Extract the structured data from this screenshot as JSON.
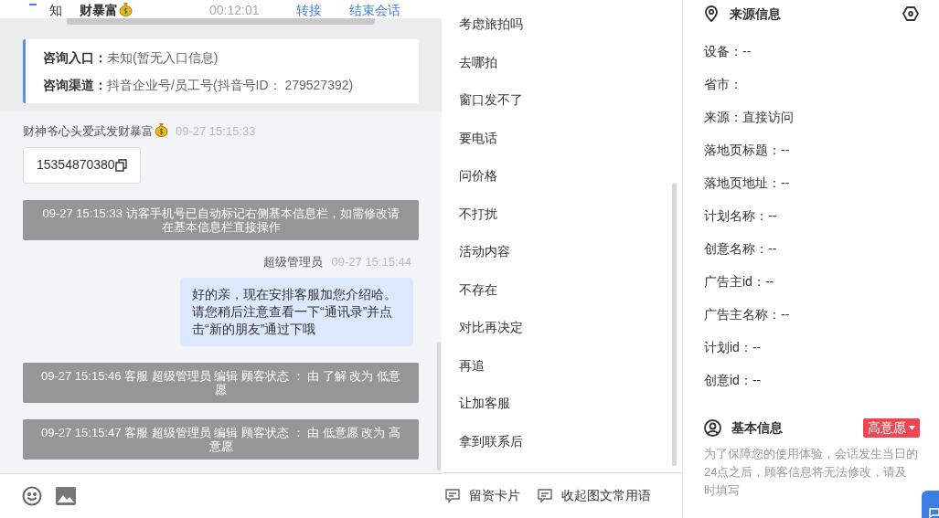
{
  "header": {
    "avatar": "知",
    "name": "财暴富",
    "duration": "00:12:01",
    "actions": [
      "转接",
      "结束会话"
    ]
  },
  "entry_card": {
    "rows": [
      {
        "label": "咨询入口：",
        "value": "未知(暂无入口信息)"
      },
      {
        "label": "咨询渠道：",
        "value": "抖音企业号/员工号(抖音号ID： 279527392)"
      }
    ]
  },
  "messages": [
    {
      "kind": "visitor",
      "sender": "财神爷心头爱武发财暴富",
      "time": "09-27 15:15:33",
      "text": "15354870380"
    },
    {
      "kind": "system",
      "text": "09-27 15:15:33 访客手机号已自动标记右侧基本信息栏，如需修改请在基本信息栏直接操作"
    },
    {
      "kind": "agent",
      "sender": "超级管理员",
      "time": "09-27 15:15:44",
      "text": "好的亲，现在安排客服加您介绍哈。请您稍后注意查看一下“通讯录”并点击“新的朋友”通过下哦"
    },
    {
      "kind": "system",
      "text": "09-27 15:15:46 客服 超级管理员 编辑 顾客状态 ： 由 了解 改为 低意愿"
    },
    {
      "kind": "system",
      "text": "09-27 15:15:47 客服 超级管理员 编辑 顾客状态 ： 由 低意愿 改为 高意愿"
    }
  ],
  "quick_replies": [
    "考虑旅拍吗",
    "去哪拍",
    "窗口发不了",
    "要电话",
    "问价格",
    "不打扰",
    "活动内容",
    "不存在",
    "对比再决定",
    "再追",
    "让加客服",
    "拿到联系后"
  ],
  "footer_buttons": [
    "留资卡片",
    "收起图文常用语"
  ],
  "source_info": {
    "title": "来源信息",
    "fields": [
      "设备：--",
      "省市：",
      "来源：直接访问",
      "落地页标题：--",
      "落地页地址：--",
      "计划名称：--",
      "创意名称：--",
      "广告主id：--",
      "广告主名称：--",
      "计划id：--",
      "创意id：--"
    ]
  },
  "basic_info": {
    "title": "基本信息",
    "status": "高意愿",
    "note": "为了保障您的使用体验，会话发生当日的24点之后，顾客信息将无法修改，请及时填写"
  }
}
